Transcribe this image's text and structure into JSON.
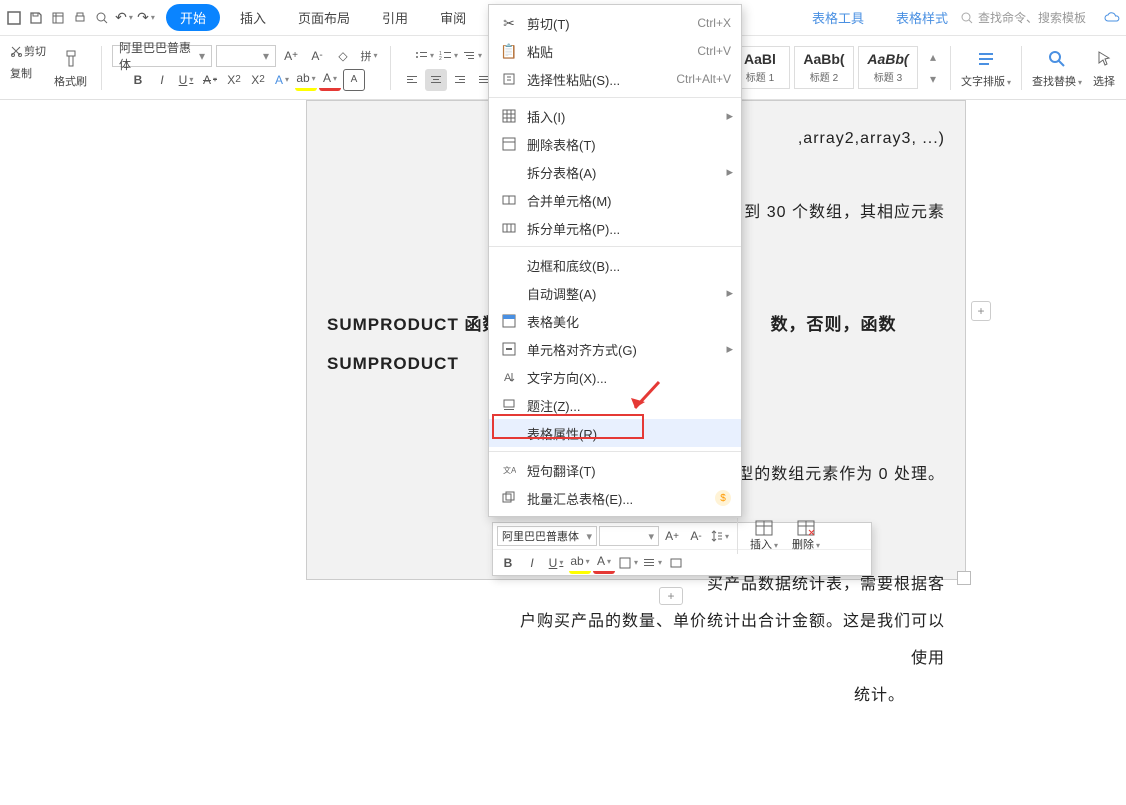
{
  "qat": {
    "undo": "↶",
    "redo": "↷"
  },
  "tabs": {
    "start": "开始",
    "insert": "插入",
    "layout": "页面布局",
    "ref": "引用",
    "review": "审阅",
    "tabletool": "表格工具",
    "tablestyle": "表格样式"
  },
  "search_placeholder": "查找命令、搜索模板",
  "ribbon": {
    "cut": "剪切",
    "copy": "复制",
    "brush": "格式刷",
    "font": "阿里巴巴普惠体",
    "font_size": "",
    "h1": {
      "prev": "AaBl",
      "lbl": "标题 1"
    },
    "h2": {
      "prev": "AaBb(",
      "lbl": "标题 2"
    },
    "h3": {
      "prev": "AaBb(",
      "lbl": "标题 3"
    },
    "textlayout": "文字排版",
    "findreplace": "查找替换",
    "select": "选择"
  },
  "doc": {
    "line_syntax": ",array2,array3, ...)",
    "line_desc1": " 2 到 30 个数组，其相应元素",
    "heading": "SUMPRODUCT 函数",
    "line_note1": "数，否则，函数 SUMPRODUCT",
    "line_note2": "数值型的数组元素作为 0 处理。",
    "line_ex1": "买产品数据统计表，需要根据客",
    "line_ex2": "户购买产品的数量、单价统计出合计金额。这是我们可以使用",
    "line_ex3": "统计。"
  },
  "menu": {
    "cut": {
      "t": "剪切(T)",
      "a": "Ctrl+X"
    },
    "paste": {
      "t": "粘贴",
      "a": "Ctrl+V"
    },
    "paste_special": {
      "t": "选择性粘贴(S)...",
      "a": "Ctrl+Alt+V"
    },
    "insert": {
      "t": "插入(I)"
    },
    "deltable": {
      "t": "删除表格(T)"
    },
    "splittable": {
      "t": "拆分表格(A)"
    },
    "mergecell": {
      "t": "合并单元格(M)"
    },
    "splitcell": {
      "t": "拆分单元格(P)..."
    },
    "border": {
      "t": "边框和底纹(B)..."
    },
    "autofit": {
      "t": "自动调整(A)"
    },
    "beautify": {
      "t": "表格美化"
    },
    "align": {
      "t": "单元格对齐方式(G)"
    },
    "textdir": {
      "t": "文字方向(X)..."
    },
    "caption": {
      "t": "题注(Z)..."
    },
    "tableprop": {
      "t": "表格属性(R)..."
    },
    "translate": {
      "t": "短句翻译(T)"
    },
    "batch": {
      "t": "批量汇总表格(E)..."
    }
  },
  "mini": {
    "font": "阿里巴巴普惠体",
    "ins": "插入",
    "del": "删除"
  }
}
